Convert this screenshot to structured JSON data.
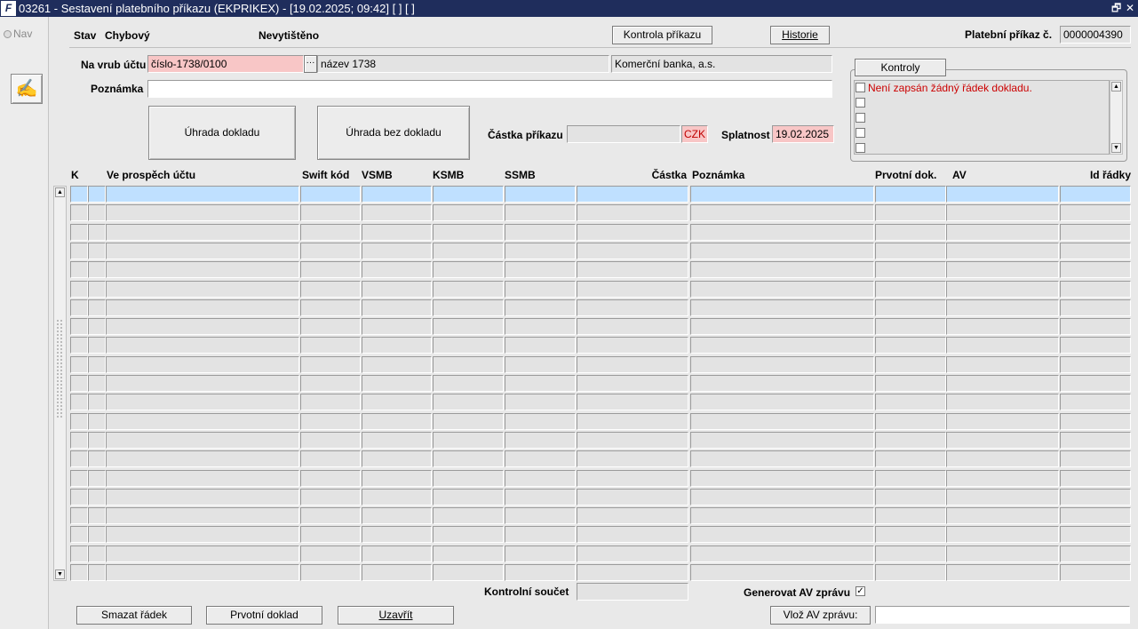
{
  "window": {
    "title": "03261 - Sestavení platebního příkazu (EKPRIKEX) - [19.02.2025; 09:42]  [ ]  [ ]",
    "logo": "F",
    "restore_glyph": "🗗",
    "close_glyph": "✕"
  },
  "left": {
    "nav_label": "Nav",
    "tool_icon": "✍"
  },
  "header": {
    "stav_label": "Stav",
    "stav_value": "Chybový",
    "print_status": "Nevytištěno",
    "kontrola_button": "Kontrola příkazu",
    "historie_button": "Historie",
    "prikaz_label": "Platební příkaz č.",
    "prikaz_value": "0000004390"
  },
  "form": {
    "na_vrub_label": "Na vrub účtu",
    "ucet_value": "číslo-1738/0100",
    "lookup_glyph": "···",
    "nazev_value": "název 1738",
    "banka_value": "Komerční banka, a.s.",
    "poznamka_label": "Poznámka",
    "poznamka_value": "",
    "uhrada_dokladu_button": "Úhrada dokladu",
    "uhrada_bez_button": "Úhrada bez dokladu",
    "castka_label": "Částka příkazu",
    "castka_value": "",
    "mena_value": "CZK",
    "splatnost_label": "Splatnost",
    "splatnost_value": "19.02.2025"
  },
  "kontroly": {
    "tab_label": "Kontroly",
    "items": [
      "Není zapsán žádný řádek dokladu.",
      "",
      "",
      "",
      ""
    ],
    "error_color": "#cc0000"
  },
  "table": {
    "columns": [
      "K",
      "Ve prospěch účtu",
      "Swift kód",
      "VSMB",
      "KSMB",
      "SSMB",
      "Částka",
      "Poznámka",
      "Prvotní dok.",
      "AV",
      "Id řádky"
    ],
    "row_count": 21,
    "selected_row": 0
  },
  "footer": {
    "kontrolni_label": "Kontrolní součet",
    "kontrolni_value": "",
    "generovat_label": "Generovat AV zprávu",
    "generovat_checked": "✓",
    "smazat_button": "Smazat řádek",
    "prvotni_button": "Prvotní doklad",
    "uzavrit_button": "Uzavřít",
    "vloz_button": "Vlož AV zprávu:",
    "vloz_value": ""
  }
}
